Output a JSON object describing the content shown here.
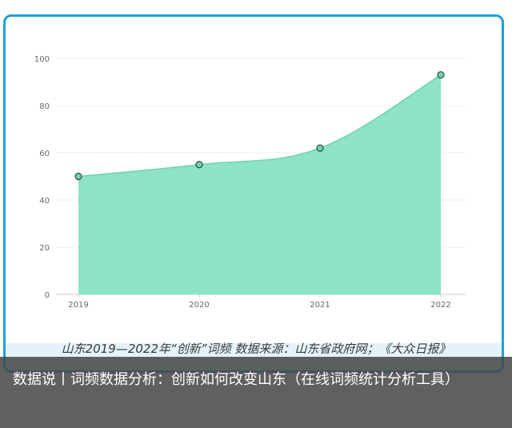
{
  "chart_data": {
    "type": "area",
    "x": [
      "2019",
      "2020",
      "2021",
      "2022"
    ],
    "values": [
      50,
      55,
      62,
      93
    ],
    "ylim": [
      0,
      100
    ],
    "yticks": [
      0,
      20,
      40,
      60,
      80,
      100
    ],
    "grid": true,
    "colors": {
      "fill": "#8ee2c6",
      "line": "#6fd3af",
      "marker_fill": "#6fd3af",
      "marker_stroke": "#2c4a40",
      "grid": "#ececec",
      "axis": "#cccccc"
    }
  },
  "caption": "山东2019—2022年“创新”词频 数据来源：山东省政府网；《大众日报》",
  "overlay": {
    "text": "数据说丨词频数据分析：创新如何改变山东（在线词频统计分析工具）"
  },
  "frame_color": "#1ea0db"
}
